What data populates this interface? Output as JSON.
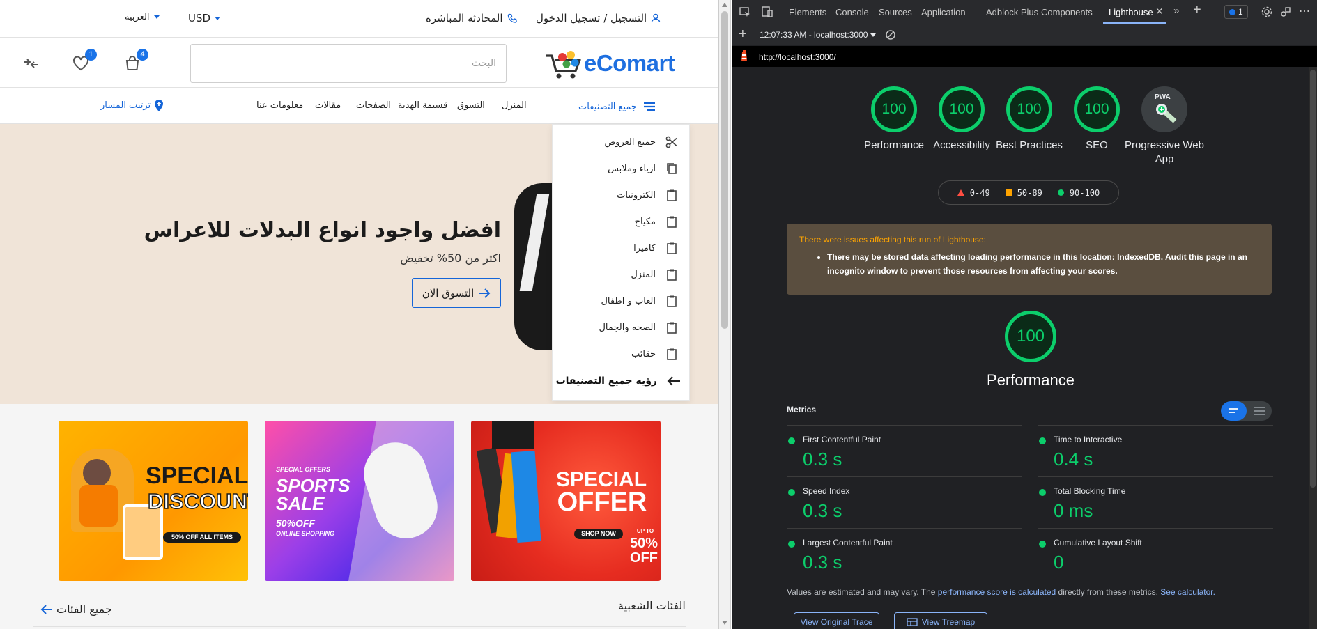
{
  "site": {
    "topbar": {
      "register": "التسجيل / تسجيل الدخول",
      "live_chat": "المحادثه المباشره",
      "currency": "USD",
      "language": "العربيه"
    },
    "header": {
      "logo": "eComart",
      "search_placeholder": "البحث",
      "cart_count": "4",
      "wishlist_count": "1"
    },
    "nav": {
      "all_categories": "جميع التصنيفات",
      "items": [
        "المنزل",
        "التسوق",
        "قسيمة الهدية",
        "الصفحات",
        "مقالات",
        "معلومات عنا"
      ],
      "track": "ترتيب المسار"
    },
    "hero": {
      "title": "افضل واجود انواع البدلات للاعراس",
      "subtitle": "اكثر من 50% تخفيض",
      "button": "التسوق الان"
    },
    "dropdown": {
      "items": [
        "جميع العروض",
        "ازياء وملابس",
        "الكترونيات",
        "مكياج",
        "كاميرا",
        "المنزل",
        "العاب و اطفال",
        "الصحه والجمال",
        "حقائب"
      ],
      "view_all": "رؤيه جميع التصنيفات"
    },
    "banners": {
      "discount": {
        "line1": "SPECIAL",
        "line2": "DISCOUNT!",
        "line3": "50% OFF ALL ITEMS"
      },
      "sports": {
        "line0": "SPECIAL OFFERS",
        "line1": "SPORTS",
        "line2": "SALE",
        "line3": "50%OFF",
        "line4": "ONLINE SHOPPING"
      },
      "offer": {
        "line1": "SPECIAL",
        "line2": "OFFER",
        "line3": "SHOP NOW",
        "line4": "UP TO",
        "line5": "50%",
        "line6": "OFF"
      }
    },
    "sections": {
      "popular": "الفئات الشعبية",
      "all_categories": "جميع الفئات"
    }
  },
  "devtools": {
    "tabs": [
      "Elements",
      "Console",
      "Sources",
      "Application",
      "Adblock Plus",
      "Components",
      "Lighthouse"
    ],
    "issues_count": "1",
    "report_time": "12:07:33 AM - localhost:3000",
    "url": "http://localhost:3000/",
    "scores": [
      {
        "label": "Performance",
        "value": "100"
      },
      {
        "label": "Accessibility",
        "value": "100"
      },
      {
        "label": "Best Practices",
        "value": "100"
      },
      {
        "label": "SEO",
        "value": "100"
      }
    ],
    "pwa_label": "Progressive Web App",
    "pwa_badge": "PWA",
    "legend": [
      "0-49",
      "50-89",
      "90-100"
    ],
    "legend_colors": {
      "fail": "#ff4e42",
      "average": "#ffa400",
      "pass": "#0cce6b"
    },
    "warning": {
      "heading": "There were issues affecting this run of Lighthouse:",
      "item": "There may be stored data affecting loading performance in this location: IndexedDB. Audit this page in an incognito window to prevent those resources from affecting your scores."
    },
    "performance": {
      "score": "100",
      "title": "Performance"
    },
    "metrics_title": "Metrics",
    "metrics": [
      {
        "name": "First Contentful Paint",
        "value": "0.3 s"
      },
      {
        "name": "Time to Interactive",
        "value": "0.4 s"
      },
      {
        "name": "Speed Index",
        "value": "0.3 s"
      },
      {
        "name": "Total Blocking Time",
        "value": "0 ms"
      },
      {
        "name": "Largest Contentful Paint",
        "value": "0.3 s"
      },
      {
        "name": "Cumulative Layout Shift",
        "value": "0"
      }
    ],
    "note": {
      "prefix": "Values are estimated and may vary. The ",
      "link1": "performance score is calculated",
      "middle": " directly from these metrics. ",
      "link2": "See calculator."
    },
    "buttons": {
      "trace": "View Original Trace",
      "treemap": "View Treemap"
    }
  }
}
